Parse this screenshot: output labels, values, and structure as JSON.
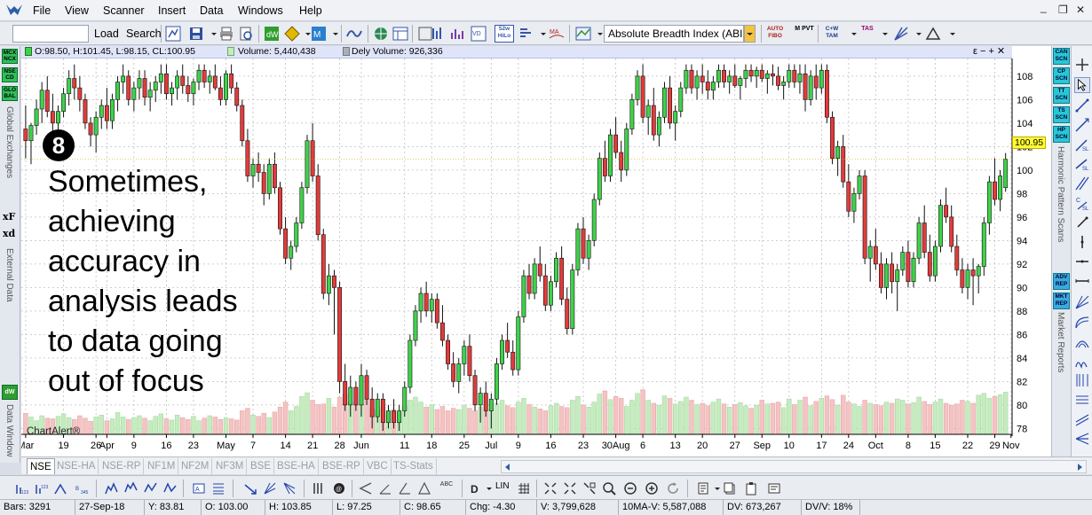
{
  "menu": {
    "items": [
      "File",
      "View",
      "Scanner",
      "Insert",
      "Data",
      "Windows",
      "Help"
    ],
    "window_minimize": "_",
    "window_restore": "❐",
    "window_close": "✕"
  },
  "toolbar": {
    "load_label": "Load",
    "search_label": "Search",
    "indicator_combo_value": "Absolute Breadth Index (ABI",
    "badges": {
      "wk52": "52w HiLo",
      "auto_fibo": "AUTO FIBO",
      "mpvt": "M PVT",
      "cw_tam": "C+W TAM",
      "tas": "TAS"
    }
  },
  "left_panel": {
    "btn_mcx": "MCX NCX",
    "btn_nse": "NSE CD",
    "btn_global": "GLO BAL",
    "global_exchanges": "Global Exchanges",
    "xf": "xF",
    "xd": "xd",
    "external_data": "External Data",
    "dw": "dW",
    "data_window": "Data Window"
  },
  "right_panel": {
    "btn_can": "CAN SCN",
    "btn_cp": "CP SCN",
    "btn_tt": "TT SCN",
    "btn_ts": "TS SCN",
    "btn_hp": "HP SCN",
    "harmonic": "Harmonic Pattern Scans",
    "btn_adv": "ADV REP",
    "btn_mkt": "MKT REP",
    "market_reports": "Market Reports"
  },
  "chart_legend": {
    "ohlc": "O:98.50, H:101.45, L:98.15, CL:100.95",
    "volume": "Volume: 5,440,438",
    "dely_volume": "Dely Volume: 926,336",
    "controls": "ε − + ✕"
  },
  "chart_overlay": {
    "step_number": "8",
    "caption_lines": [
      "Sometimes,",
      "achieving",
      "accuracy in",
      "analysis leads",
      "to data going",
      "out of focus"
    ],
    "watermark": "ChartAlert®"
  },
  "chart_data": {
    "type": "candlestick",
    "y_axis_ticks": [
      78,
      80,
      82,
      84,
      86,
      88,
      90,
      92,
      94,
      96,
      98,
      100,
      102,
      104,
      106,
      108
    ],
    "ylim": [
      77.5,
      109.5
    ],
    "last_price_label": "100.95",
    "last_price": 100.95,
    "x_tick_labels": [
      "Mar",
      "19",
      "26",
      "Apr",
      "9",
      "16",
      "23",
      "May",
      "7",
      "14",
      "21",
      "28",
      "Jun",
      "11",
      "18",
      "25",
      "Jul",
      "9",
      "16",
      "23",
      "30Aug",
      "6",
      "13",
      "20",
      "27",
      "Sep",
      "10",
      "17",
      "24",
      "Oct",
      "8",
      "15",
      "22",
      "29",
      "Nov"
    ],
    "x_tick_index": [
      0,
      7,
      13,
      15,
      20,
      26,
      31,
      37,
      42,
      48,
      53,
      58,
      62,
      70,
      75,
      81,
      86,
      91,
      97,
      103,
      109,
      114,
      120,
      125,
      131,
      136,
      141,
      147,
      152,
      157,
      163,
      168,
      174,
      179,
      182
    ],
    "candles": [
      [
        103.5,
        105.5,
        101.0,
        102.5
      ],
      [
        102.5,
        104.0,
        100.5,
        103.8
      ],
      [
        103.8,
        106.0,
        103.0,
        105.2
      ],
      [
        105.2,
        107.5,
        104.0,
        106.8
      ],
      [
        106.8,
        108.0,
        104.5,
        105.0
      ],
      [
        105.0,
        106.5,
        103.0,
        104.0
      ],
      [
        104.0,
        105.5,
        102.5,
        105.0
      ],
      [
        105.0,
        107.0,
        104.5,
        106.5
      ],
      [
        106.5,
        108.5,
        105.5,
        107.8
      ],
      [
        107.8,
        109.0,
        106.0,
        107.0
      ],
      [
        107.0,
        108.0,
        105.0,
        106.0
      ],
      [
        106.0,
        106.5,
        103.5,
        104.0
      ],
      [
        104.0,
        104.5,
        102.0,
        103.0
      ],
      [
        103.0,
        105.0,
        101.5,
        104.5
      ],
      [
        104.5,
        106.0,
        103.5,
        105.5
      ],
      [
        105.5,
        107.0,
        103.5,
        104.2
      ],
      [
        104.2,
        106.5,
        103.5,
        106.0
      ],
      [
        106.0,
        108.0,
        105.0,
        107.5
      ],
      [
        107.5,
        109.0,
        106.5,
        108.0
      ],
      [
        108.0,
        108.5,
        105.5,
        106.0
      ],
      [
        106.0,
        107.5,
        105.0,
        107.0
      ],
      [
        107.0,
        108.5,
        106.0,
        107.8
      ],
      [
        107.8,
        108.5,
        105.5,
        106.2
      ],
      [
        106.2,
        107.5,
        105.0,
        106.8
      ],
      [
        106.8,
        108.0,
        105.8,
        107.5
      ],
      [
        107.5,
        109.0,
        106.5,
        108.2
      ],
      [
        108.2,
        109.0,
        106.0,
        106.5
      ],
      [
        106.5,
        107.5,
        105.5,
        107.0
      ],
      [
        107.0,
        108.5,
        106.0,
        108.0
      ],
      [
        108.0,
        109.0,
        106.5,
        107.2
      ],
      [
        107.2,
        108.0,
        105.8,
        106.5
      ],
      [
        106.5,
        107.8,
        105.5,
        107.5
      ],
      [
        107.5,
        109.0,
        106.8,
        108.5
      ],
      [
        108.5,
        109.0,
        107.0,
        107.5
      ],
      [
        107.5,
        108.5,
        106.5,
        108.0
      ],
      [
        108.0,
        109.0,
        106.8,
        107.0
      ],
      [
        107.0,
        108.0,
        105.5,
        106.0
      ],
      [
        106.0,
        108.5,
        105.5,
        108.2
      ],
      [
        108.2,
        109.0,
        106.5,
        107.0
      ],
      [
        107.0,
        107.5,
        105.0,
        105.5
      ],
      [
        105.5,
        106.0,
        102.0,
        102.5
      ],
      [
        102.5,
        103.5,
        99.0,
        99.5
      ],
      [
        99.5,
        101.0,
        98.5,
        100.5
      ],
      [
        100.5,
        101.5,
        99.0,
        99.8
      ],
      [
        99.8,
        100.5,
        97.0,
        98.0
      ],
      [
        98.0,
        101.0,
        97.5,
        100.5
      ],
      [
        100.5,
        101.5,
        98.0,
        98.5
      ],
      [
        98.5,
        99.0,
        94.5,
        95.0
      ],
      [
        95.0,
        96.0,
        92.0,
        92.5
      ],
      [
        92.5,
        94.0,
        91.5,
        93.5
      ],
      [
        93.5,
        96.0,
        93.0,
        95.5
      ],
      [
        95.5,
        99.0,
        95.0,
        98.5
      ],
      [
        98.5,
        103.0,
        98.0,
        102.5
      ],
      [
        102.5,
        104.0,
        99.0,
        99.5
      ],
      [
        99.5,
        100.5,
        94.0,
        94.5
      ],
      [
        94.5,
        95.0,
        89.0,
        89.5
      ],
      [
        89.5,
        92.0,
        88.5,
        91.0
      ],
      [
        91.0,
        91.5,
        86.0,
        90.0
      ],
      [
        90.0,
        90.5,
        81.0,
        82.0
      ],
      [
        82.0,
        83.5,
        79.5,
        80.0
      ],
      [
        80.0,
        82.5,
        79.0,
        81.5
      ],
      [
        81.5,
        82.0,
        79.5,
        80.0
      ],
      [
        80.0,
        83.5,
        79.0,
        82.5
      ],
      [
        82.5,
        83.0,
        80.0,
        80.5
      ],
      [
        80.5,
        81.5,
        78.0,
        79.0
      ],
      [
        79.0,
        81.0,
        78.5,
        80.5
      ],
      [
        80.5,
        81.0,
        77.8,
        78.5
      ],
      [
        78.5,
        80.0,
        78.0,
        79.5
      ],
      [
        79.5,
        80.5,
        78.0,
        78.5
      ],
      [
        78.5,
        80.0,
        77.8,
        79.5
      ],
      [
        79.5,
        82.0,
        79.0,
        81.5
      ],
      [
        81.5,
        86.0,
        81.0,
        85.5
      ],
      [
        85.5,
        88.5,
        85.0,
        88.0
      ],
      [
        88.0,
        90.0,
        87.0,
        89.5
      ],
      [
        89.5,
        90.5,
        87.5,
        88.0
      ],
      [
        88.0,
        89.5,
        87.0,
        89.0
      ],
      [
        89.0,
        89.5,
        86.5,
        87.0
      ],
      [
        87.0,
        88.5,
        85.0,
        85.5
      ],
      [
        85.5,
        86.0,
        83.0,
        83.5
      ],
      [
        83.5,
        84.5,
        81.5,
        82.0
      ],
      [
        82.0,
        84.0,
        81.0,
        83.5
      ],
      [
        83.5,
        85.5,
        82.5,
        85.0
      ],
      [
        85.0,
        86.0,
        82.0,
        82.5
      ],
      [
        82.5,
        83.0,
        79.5,
        80.0
      ],
      [
        80.0,
        81.5,
        78.5,
        81.0
      ],
      [
        81.0,
        82.0,
        79.0,
        79.5
      ],
      [
        79.5,
        81.0,
        78.0,
        80.5
      ],
      [
        80.5,
        84.0,
        80.0,
        83.5
      ],
      [
        83.5,
        86.0,
        83.0,
        85.5
      ],
      [
        85.5,
        87.0,
        84.0,
        84.5
      ],
      [
        84.5,
        85.5,
        82.5,
        83.0
      ],
      [
        83.0,
        88.0,
        82.5,
        87.5
      ],
      [
        87.5,
        91.5,
        87.0,
        91.0
      ],
      [
        91.0,
        92.0,
        89.0,
        89.5
      ],
      [
        89.5,
        92.5,
        89.0,
        92.0
      ],
      [
        92.0,
        93.5,
        90.5,
        91.0
      ],
      [
        91.0,
        92.0,
        88.0,
        88.5
      ],
      [
        88.5,
        91.0,
        88.0,
        90.5
      ],
      [
        90.5,
        93.0,
        90.0,
        92.5
      ],
      [
        92.5,
        93.5,
        88.5,
        89.0
      ],
      [
        89.0,
        90.0,
        86.0,
        86.5
      ],
      [
        86.5,
        92.0,
        86.0,
        91.5
      ],
      [
        91.5,
        95.5,
        91.0,
        95.0
      ],
      [
        95.0,
        96.0,
        92.0,
        92.5
      ],
      [
        92.5,
        94.5,
        91.5,
        94.0
      ],
      [
        94.0,
        98.0,
        93.5,
        97.5
      ],
      [
        97.5,
        101.5,
        97.0,
        101.0
      ],
      [
        101.0,
        102.5,
        99.0,
        99.5
      ],
      [
        99.5,
        103.5,
        99.0,
        103.0
      ],
      [
        103.0,
        104.5,
        101.0,
        101.5
      ],
      [
        101.5,
        102.5,
        99.0,
        100.0
      ],
      [
        100.0,
        104.0,
        99.5,
        103.5
      ],
      [
        103.5,
        106.5,
        103.0,
        106.0
      ],
      [
        106.0,
        108.5,
        105.5,
        108.0
      ],
      [
        108.0,
        109.0,
        104.0,
        104.5
      ],
      [
        104.5,
        106.0,
        103.0,
        105.5
      ],
      [
        105.5,
        107.0,
        102.5,
        103.0
      ],
      [
        103.0,
        105.0,
        102.0,
        104.5
      ],
      [
        104.5,
        107.5,
        104.0,
        107.0
      ],
      [
        107.0,
        108.0,
        103.5,
        104.0
      ],
      [
        104.0,
        105.5,
        102.5,
        105.0
      ],
      [
        105.0,
        107.5,
        104.5,
        107.0
      ],
      [
        107.0,
        109.0,
        106.5,
        108.5
      ],
      [
        108.5,
        109.0,
        106.5,
        107.0
      ],
      [
        107.0,
        108.5,
        106.0,
        108.0
      ],
      [
        108.0,
        109.0,
        106.5,
        107.5
      ],
      [
        107.5,
        108.5,
        106.0,
        106.8
      ],
      [
        106.8,
        108.0,
        106.0,
        107.5
      ],
      [
        107.5,
        109.0,
        107.0,
        108.5
      ],
      [
        108.5,
        109.0,
        107.0,
        107.5
      ],
      [
        107.5,
        108.5,
        106.5,
        108.0
      ],
      [
        108.0,
        109.0,
        107.0,
        107.2
      ],
      [
        107.2,
        108.0,
        106.0,
        107.8
      ],
      [
        107.8,
        109.0,
        107.0,
        108.5
      ],
      [
        108.5,
        109.0,
        107.5,
        108.0
      ],
      [
        108.0,
        108.8,
        107.0,
        108.5
      ],
      [
        108.5,
        109.0,
        107.5,
        107.8
      ],
      [
        107.8,
        108.5,
        106.5,
        108.2
      ],
      [
        108.2,
        109.0,
        107.2,
        108.0
      ],
      [
        108.0,
        108.8,
        106.8,
        107.2
      ],
      [
        107.2,
        108.0,
        106.0,
        107.5
      ],
      [
        107.5,
        109.0,
        107.0,
        108.5
      ],
      [
        108.5,
        109.0,
        107.0,
        107.5
      ],
      [
        107.5,
        109.0,
        106.5,
        108.2
      ],
      [
        108.2,
        109.0,
        105.0,
        106.0
      ],
      [
        106.0,
        108.5,
        105.5,
        108.0
      ],
      [
        108.0,
        109.0,
        106.0,
        107.0
      ],
      [
        107.0,
        109.0,
        106.5,
        108.5
      ],
      [
        108.5,
        109.0,
        104.0,
        104.5
      ],
      [
        104.5,
        105.0,
        100.5,
        101.0
      ],
      [
        101.0,
        102.5,
        99.5,
        102.0
      ],
      [
        102.0,
        103.0,
        98.5,
        99.0
      ],
      [
        99.0,
        100.5,
        96.0,
        96.5
      ],
      [
        96.5,
        98.5,
        95.5,
        98.0
      ],
      [
        98.0,
        100.0,
        97.5,
        99.5
      ],
      [
        99.5,
        100.0,
        92.0,
        92.5
      ],
      [
        92.5,
        94.0,
        90.5,
        93.5
      ],
      [
        93.5,
        95.0,
        91.5,
        92.0
      ],
      [
        92.0,
        93.0,
        89.5,
        90.0
      ],
      [
        90.0,
        92.5,
        89.0,
        92.0
      ],
      [
        92.0,
        93.0,
        89.5,
        90.5
      ],
      [
        90.5,
        92.0,
        88.0,
        91.5
      ],
      [
        91.5,
        93.5,
        91.0,
        93.0
      ],
      [
        93.0,
        94.0,
        90.0,
        90.5
      ],
      [
        90.5,
        93.0,
        90.0,
        92.5
      ],
      [
        92.5,
        96.0,
        92.0,
        95.5
      ],
      [
        95.5,
        97.0,
        92.5,
        93.0
      ],
      [
        93.0,
        94.5,
        90.5,
        91.0
      ],
      [
        91.0,
        94.0,
        90.5,
        93.5
      ],
      [
        93.5,
        97.5,
        93.0,
        97.0
      ],
      [
        97.0,
        98.5,
        95.5,
        96.0
      ],
      [
        96.0,
        97.0,
        93.0,
        93.5
      ],
      [
        93.5,
        94.5,
        91.0,
        91.5
      ],
      [
        91.5,
        92.5,
        89.5,
        90.0
      ],
      [
        90.0,
        92.0,
        89.0,
        91.5
      ],
      [
        91.5,
        92.5,
        88.5,
        91.0
      ],
      [
        91.0,
        92.0,
        89.5,
        91.8
      ],
      [
        91.8,
        96.0,
        91.0,
        95.5
      ],
      [
        95.5,
        99.5,
        94.5,
        99.0
      ],
      [
        99.0,
        101.0,
        97.0,
        97.5
      ],
      [
        97.5,
        100.0,
        96.5,
        99.5
      ],
      [
        98.5,
        101.45,
        98.15,
        100.95
      ]
    ],
    "volumes": [
      34,
      28,
      22,
      30,
      26,
      25,
      29,
      33,
      27,
      24,
      30,
      26,
      21,
      28,
      31,
      22,
      25,
      35,
      28,
      24,
      27,
      30,
      26,
      22,
      29,
      33,
      25,
      23,
      31,
      27,
      24,
      29,
      22,
      26,
      30,
      28,
      24,
      27,
      25,
      23,
      38,
      42,
      31,
      29,
      34,
      27,
      36,
      44,
      52,
      38,
      45,
      61,
      67,
      55,
      48,
      49,
      58,
      44,
      60,
      65,
      52,
      47,
      49,
      58,
      42,
      39,
      44,
      37,
      40,
      35,
      46,
      55,
      60,
      52,
      44,
      48,
      40,
      45,
      38,
      42,
      40,
      46,
      42,
      38,
      44,
      37,
      41,
      50,
      55,
      46,
      43,
      52,
      58,
      48,
      44,
      41,
      38,
      46,
      50,
      45,
      43,
      55,
      61,
      47,
      44,
      52,
      65,
      70,
      56,
      61,
      58,
      45,
      55,
      66,
      72,
      55,
      50,
      47,
      62,
      58,
      49,
      53,
      60,
      55,
      48,
      50,
      46,
      52,
      57,
      49,
      44,
      48,
      51,
      46,
      42,
      47,
      55,
      49,
      50,
      52,
      43,
      57,
      48,
      55,
      60,
      46,
      53,
      58,
      62,
      56,
      47,
      63,
      52,
      49,
      45,
      55,
      50,
      48,
      46,
      52,
      50,
      57,
      55,
      49,
      51,
      60,
      53,
      48,
      52,
      57,
      50,
      47,
      49,
      55,
      53,
      50,
      63,
      66,
      58,
      61,
      64,
      68
    ]
  },
  "tabs": [
    "NSE",
    "NSE-HA",
    "NSE-RP",
    "NF1M",
    "NF2M",
    "NF3M",
    "BSE",
    "BSE-HA",
    "BSE-RP",
    "VBC",
    "TS-Stats"
  ],
  "bottom_toolbar": {
    "lin_label": "LIN",
    "abc_label": "ABC"
  },
  "status": {
    "bars": "Bars: 3291",
    "date": "27-Sep-18",
    "y": "Y: 83.81",
    "open": "O: 103.00",
    "high": "H: 103.85",
    "low": "L: 97.25",
    "close": "C: 98.65",
    "chg": "Chg: -4.30",
    "volume": "V: 3,799,628",
    "ma": "10MA-V: 5,587,088",
    "dv": "DV: 673,267",
    "dvv": "DV/V: 18%"
  },
  "colors": {
    "up": "#3fd24a",
    "down": "#e23b3b",
    "vol_up": "#c5ecbf",
    "vol_down": "#f4c3c3",
    "grid": "#bfbfbf"
  }
}
